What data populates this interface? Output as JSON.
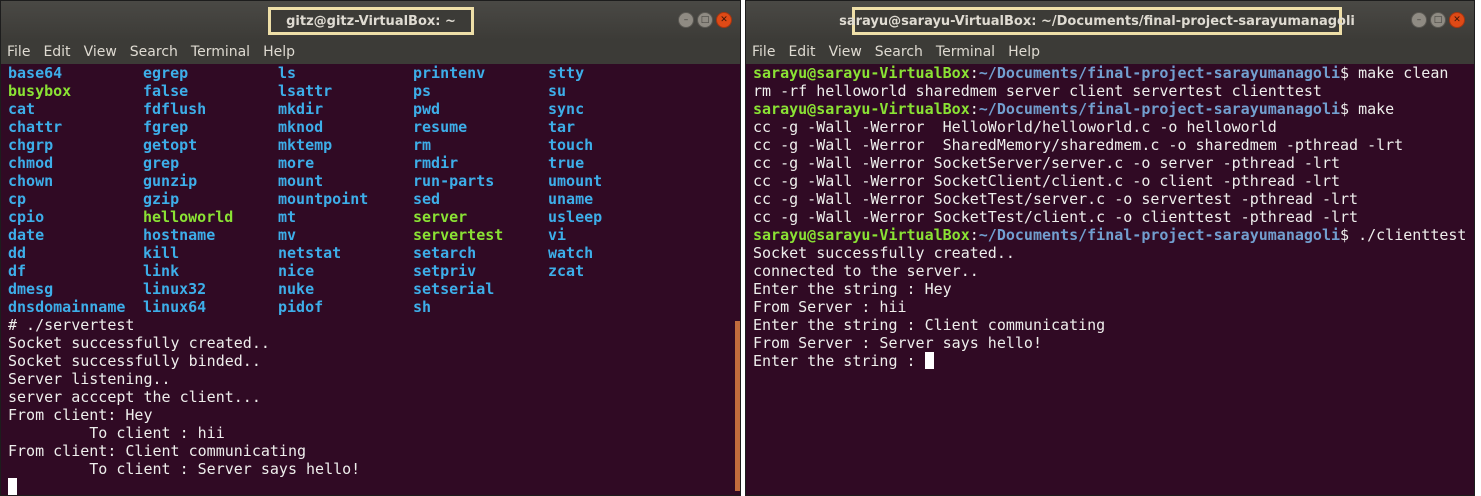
{
  "left": {
    "title": "gitz@gitz-VirtualBox: ~",
    "menu": [
      "File",
      "Edit",
      "View",
      "Search",
      "Terminal",
      "Help"
    ],
    "ls_rows": [
      [
        {
          "t": "base64",
          "c": "blue"
        },
        {
          "t": "egrep",
          "c": "blue"
        },
        {
          "t": "ls",
          "c": "blue"
        },
        {
          "t": "printenv",
          "c": "blue"
        },
        {
          "t": "stty",
          "c": "blue"
        }
      ],
      [
        {
          "t": "busybox",
          "c": "green"
        },
        {
          "t": "false",
          "c": "blue"
        },
        {
          "t": "lsattr",
          "c": "blue"
        },
        {
          "t": "ps",
          "c": "blue"
        },
        {
          "t": "su",
          "c": "blue"
        }
      ],
      [
        {
          "t": "cat",
          "c": "blue"
        },
        {
          "t": "fdflush",
          "c": "blue"
        },
        {
          "t": "mkdir",
          "c": "blue"
        },
        {
          "t": "pwd",
          "c": "blue"
        },
        {
          "t": "sync",
          "c": "blue"
        }
      ],
      [
        {
          "t": "chattr",
          "c": "blue"
        },
        {
          "t": "fgrep",
          "c": "blue"
        },
        {
          "t": "mknod",
          "c": "blue"
        },
        {
          "t": "resume",
          "c": "blue"
        },
        {
          "t": "tar",
          "c": "blue"
        }
      ],
      [
        {
          "t": "chgrp",
          "c": "blue"
        },
        {
          "t": "getopt",
          "c": "blue"
        },
        {
          "t": "mktemp",
          "c": "blue"
        },
        {
          "t": "rm",
          "c": "blue"
        },
        {
          "t": "touch",
          "c": "blue"
        }
      ],
      [
        {
          "t": "chmod",
          "c": "blue"
        },
        {
          "t": "grep",
          "c": "blue"
        },
        {
          "t": "more",
          "c": "blue"
        },
        {
          "t": "rmdir",
          "c": "blue"
        },
        {
          "t": "true",
          "c": "blue"
        }
      ],
      [
        {
          "t": "chown",
          "c": "blue"
        },
        {
          "t": "gunzip",
          "c": "blue"
        },
        {
          "t": "mount",
          "c": "blue"
        },
        {
          "t": "run-parts",
          "c": "blue"
        },
        {
          "t": "umount",
          "c": "blue"
        }
      ],
      [
        {
          "t": "cp",
          "c": "blue"
        },
        {
          "t": "gzip",
          "c": "blue"
        },
        {
          "t": "mountpoint",
          "c": "blue"
        },
        {
          "t": "sed",
          "c": "blue"
        },
        {
          "t": "uname",
          "c": "blue"
        }
      ],
      [
        {
          "t": "cpio",
          "c": "blue"
        },
        {
          "t": "helloworld",
          "c": "green"
        },
        {
          "t": "mt",
          "c": "blue"
        },
        {
          "t": "server",
          "c": "green"
        },
        {
          "t": "usleep",
          "c": "blue"
        }
      ],
      [
        {
          "t": "date",
          "c": "blue"
        },
        {
          "t": "hostname",
          "c": "blue"
        },
        {
          "t": "mv",
          "c": "blue"
        },
        {
          "t": "servertest",
          "c": "green"
        },
        {
          "t": "vi",
          "c": "blue"
        }
      ],
      [
        {
          "t": "dd",
          "c": "blue"
        },
        {
          "t": "kill",
          "c": "blue"
        },
        {
          "t": "netstat",
          "c": "blue"
        },
        {
          "t": "setarch",
          "c": "blue"
        },
        {
          "t": "watch",
          "c": "blue"
        }
      ],
      [
        {
          "t": "df",
          "c": "blue"
        },
        {
          "t": "link",
          "c": "blue"
        },
        {
          "t": "nice",
          "c": "blue"
        },
        {
          "t": "setpriv",
          "c": "blue"
        },
        {
          "t": "zcat",
          "c": "blue"
        }
      ],
      [
        {
          "t": "dmesg",
          "c": "blue"
        },
        {
          "t": "linux32",
          "c": "blue"
        },
        {
          "t": "nuke",
          "c": "blue"
        },
        {
          "t": "setserial",
          "c": "blue"
        },
        {
          "t": "",
          "c": "blue"
        }
      ],
      [
        {
          "t": "dnsdomainname",
          "c": "blue"
        },
        {
          "t": "linux64",
          "c": "blue"
        },
        {
          "t": "pidof",
          "c": "blue"
        },
        {
          "t": "sh",
          "c": "blue"
        },
        {
          "t": "",
          "c": "blue"
        }
      ]
    ],
    "output": [
      "# ./servertest",
      "Socket successfully created..",
      "Socket successfully binded..",
      "Server listening..",
      "server acccept the client...",
      "From client: Hey",
      "         To client : hii",
      "From client: Client communicating",
      "         To client : Server says hello!"
    ]
  },
  "right": {
    "title": "sarayu@sarayu-VirtualBox: ~/Documents/final-project-sarayumanagoli",
    "menu": [
      "File",
      "Edit",
      "View",
      "Search",
      "Terminal",
      "Help"
    ],
    "lines": [
      {
        "type": "prompt",
        "user": "sarayu@sarayu-VirtualBox",
        "path": "~/Documents/final-project-sarayumanagoli",
        "cmd": "$ make clean"
      },
      {
        "type": "text",
        "text": "rm -rf helloworld sharedmem server client servertest clienttest"
      },
      {
        "type": "prompt",
        "user": "sarayu@sarayu-VirtualBox",
        "path": "~/Documents/final-project-sarayumanagoli",
        "cmd": "$ make"
      },
      {
        "type": "text",
        "text": "cc -g -Wall -Werror  HelloWorld/helloworld.c -o helloworld"
      },
      {
        "type": "text",
        "text": "cc -g -Wall -Werror  SharedMemory/sharedmem.c -o sharedmem -pthread -lrt"
      },
      {
        "type": "text",
        "text": "cc -g -Wall -Werror SocketServer/server.c -o server -pthread -lrt"
      },
      {
        "type": "text",
        "text": "cc -g -Wall -Werror SocketClient/client.c -o client -pthread -lrt"
      },
      {
        "type": "text",
        "text": "cc -g -Wall -Werror SocketTest/server.c -o servertest -pthread -lrt"
      },
      {
        "type": "text",
        "text": "cc -g -Wall -Werror SocketTest/client.c -o clienttest -pthread -lrt"
      },
      {
        "type": "prompt",
        "user": "sarayu@sarayu-VirtualBox",
        "path": "~/Documents/final-project-sarayumanagoli",
        "cmd": "$ ./clienttest"
      },
      {
        "type": "text",
        "text": "Socket successfully created.."
      },
      {
        "type": "text",
        "text": "connected to the server.."
      },
      {
        "type": "text",
        "text": "Enter the string : Hey"
      },
      {
        "type": "text",
        "text": "From Server : hii"
      },
      {
        "type": "text",
        "text": "Enter the string : Client communicating"
      },
      {
        "type": "text",
        "text": "From Server : Server says hello!"
      },
      {
        "type": "input",
        "text": "Enter the string : "
      }
    ]
  },
  "icons": {
    "minimize": "minimize-icon",
    "maximize": "maximize-icon",
    "close": "close-icon"
  },
  "colors": {
    "terminal_bg": "#300a24",
    "accent_title_border": "#eedfa8",
    "close_button": "#df4a16"
  }
}
